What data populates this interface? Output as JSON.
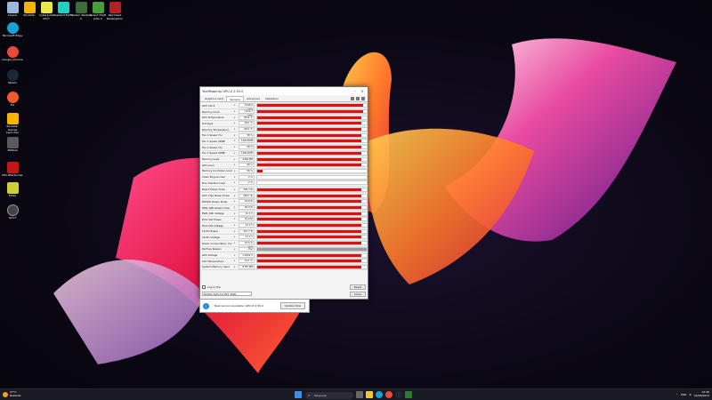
{
  "desktop": {
    "icons": [
      {
        "label": "Lixeira",
        "color": "#9fb8d8"
      },
      {
        "label": "Rockstar",
        "color": "#f5b400"
      },
      {
        "label": "Cyberpunk 2077",
        "color": "#e8e84a"
      },
      {
        "label": "Resident Evil 4",
        "color": "#1fd1c2"
      },
      {
        "label": "Modern Warfare II",
        "color": "#3b6d3a"
      },
      {
        "label": "Grand Theft Auto V",
        "color": "#4a9c3c"
      },
      {
        "label": "Red Dead Redemption",
        "color": "#b52020"
      },
      {
        "label": "Microsoft Edge",
        "color": "#1aa0d8"
      },
      {
        "label": "Google Chrome",
        "color": "#e84a3a"
      },
      {
        "label": "Steam",
        "color": "#1b2838"
      },
      {
        "label": "EA",
        "color": "#f05a28"
      },
      {
        "label": "Rockstar Games Launcher",
        "color": "#f5b400"
      },
      {
        "label": "3DMark",
        "color": "#5a5a5a"
      },
      {
        "label": "MSI Afterburner",
        "color": "#c01818"
      },
      {
        "label": "EVGA",
        "color": "#cfcf3a"
      },
      {
        "label": "OCCT",
        "color": "#444444"
      }
    ]
  },
  "window": {
    "title": "TechPowerUp GPU-Z 2.55.0",
    "tabs": [
      "Graphics Card",
      "Sensors",
      "Advanced",
      "Validation"
    ],
    "active_tab": "Sensors",
    "sensors": [
      {
        "name": "GPU Clock",
        "value": "2745.0 MHz",
        "fill": 0.97
      },
      {
        "name": "Memory Clock",
        "value": "1312.7 MHz",
        "fill": 0.97
      },
      {
        "name": "GPU Temperature",
        "value": "66.8 °C",
        "fill": 0.95
      },
      {
        "name": "Hot Spot",
        "value": "78.0 °C",
        "fill": 0.95
      },
      {
        "name": "Memory Temperature",
        "value": "68.0 °C",
        "fill": 0.95
      },
      {
        "name": "Fan 1 Speed (%)",
        "value": "58 %",
        "fill": 0.95
      },
      {
        "name": "Fan 1 Speed (RPM)",
        "value": "1460 RPM",
        "fill": 0.95
      },
      {
        "name": "Fan 2 Speed (%)",
        "value": "58 %",
        "fill": 0.95
      },
      {
        "name": "Fan 2 Speed (RPM)",
        "value": "1484 RPM",
        "fill": 0.95
      },
      {
        "name": "Memory Used",
        "value": "4556 MB",
        "fill": 0.95
      },
      {
        "name": "GPU Load",
        "value": "99 %",
        "fill": 0.95
      },
      {
        "name": "Memory Controller Load",
        "value": "56 %",
        "fill": 0.05
      },
      {
        "name": "Video Engine Load",
        "value": "0 %",
        "fill": 0
      },
      {
        "name": "Bus Interface Load",
        "value": "2 %",
        "fill": 0
      },
      {
        "name": "Board Power Draw",
        "value": "436.3 W",
        "fill": 0.95
      },
      {
        "name": "GPU Chip Power Draw",
        "value": "265.1 W",
        "fill": 0.95
      },
      {
        "name": "MVDDC Power Draw",
        "value": "44.8 W",
        "fill": 0.95
      },
      {
        "name": "PWR_SRC Power Draw",
        "value": "90.0 W",
        "fill": 0.95
      },
      {
        "name": "PWR_SRC Voltage",
        "value": "12.1 V",
        "fill": 0.95
      },
      {
        "name": "PCIe Slot Power",
        "value": "22.0 W",
        "fill": 0.95
      },
      {
        "name": "PCIe Slot Voltage",
        "value": "12.2 V",
        "fill": 0.95
      },
      {
        "name": "16-Pin Power",
        "value": "397.7 W",
        "fill": 0.95
      },
      {
        "name": "16-Pin Voltage",
        "value": "12.1 V",
        "fill": 0.95
      },
      {
        "name": "Power Consumption (%)",
        "value": "97.6 % TDP",
        "fill": 0.95
      },
      {
        "name": "PerfCap Reason",
        "value": "Pwr",
        "fill": 1.0,
        "grey": true
      },
      {
        "name": "GPU Voltage",
        "value": "1.0500 V",
        "fill": 0.95
      },
      {
        "name": "CPU Temperature",
        "value": "72.0 °C",
        "fill": 0.95
      },
      {
        "name": "System Memory Used",
        "value": "8787 MB",
        "fill": 0.95
      }
    ],
    "log_label": "Log to file",
    "reset_label": "Reset",
    "gpu_select": "NVIDIA GeForce RTX 4090",
    "close_label": "Close",
    "notification": {
      "text": "New version available: GPU-Z 2.56.0",
      "button": "Update Now"
    }
  },
  "taskbar": {
    "weather_temp": "27°C",
    "weather_cond": "Nublado",
    "search_placeholder": "Pesquisar",
    "language": "POR",
    "time": "12:36",
    "date": "24/08/2023"
  }
}
